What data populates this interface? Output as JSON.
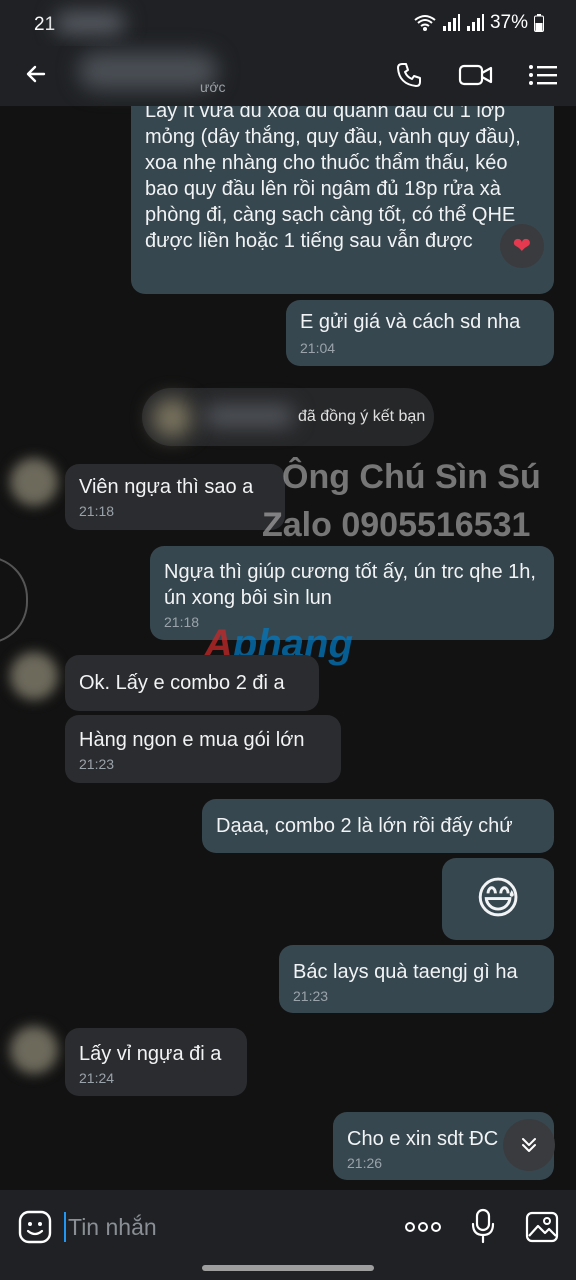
{
  "status": {
    "time": "21",
    "battery": "37%"
  },
  "header": {
    "subtitle": "ước",
    "icons": [
      "back-arrow-icon",
      "phone-icon",
      "video-icon",
      "menu-icon"
    ]
  },
  "messages": [
    {
      "text": "Lấy ít vừa đủ xoa đủ quanh đầu cu 1 lớp mỏng (dây thắng, quy đầu, vành quy đầu),  xoa nhẹ nhàng cho thuốc thẩm thấu, kéo bao quy đầu lên rồi ngâm đủ 18p rửa xà phòng đi, càng sạch càng tốt, có thể QHE được liền hoặc 1 tiếng sau vẫn được",
      "time": ""
    },
    {
      "text": "E gửi giá và cách sd nha",
      "time": "21:04"
    },
    {
      "text": "đã đồng ý kết bạn",
      "time": ""
    },
    {
      "text": "Viên ngựa thì sao a",
      "time": "21:18"
    },
    {
      "text": "Ngựa thì giúp cương tốt ấy, ún trc qhe 1h, ún xong bôi sìn lun",
      "time": "21:18"
    },
    {
      "text": "Ok. Lấy e combo 2 đi a",
      "time": ""
    },
    {
      "text": "Hàng ngon e mua gói lớn",
      "time": "21:23"
    },
    {
      "text": "Dạaa, combo 2 là lớn rồi đấy chứ",
      "time": ""
    },
    {
      "text": "😅",
      "time": ""
    },
    {
      "text": "Bác lays quà taengj gì ha",
      "time": "21:23"
    },
    {
      "text": "Lấy vỉ ngựa đi a",
      "time": "21:24"
    },
    {
      "text": "Cho e xin sdt ĐC",
      "time": "21:26"
    }
  ],
  "watermarks": {
    "line1": "Ông Chú Sìn Sú",
    "line2": "Zalo 0905516531",
    "logo_a": "A",
    "logo_b": "phang"
  },
  "reaction": "❤",
  "composer": {
    "placeholder": "Tin nhắn"
  }
}
